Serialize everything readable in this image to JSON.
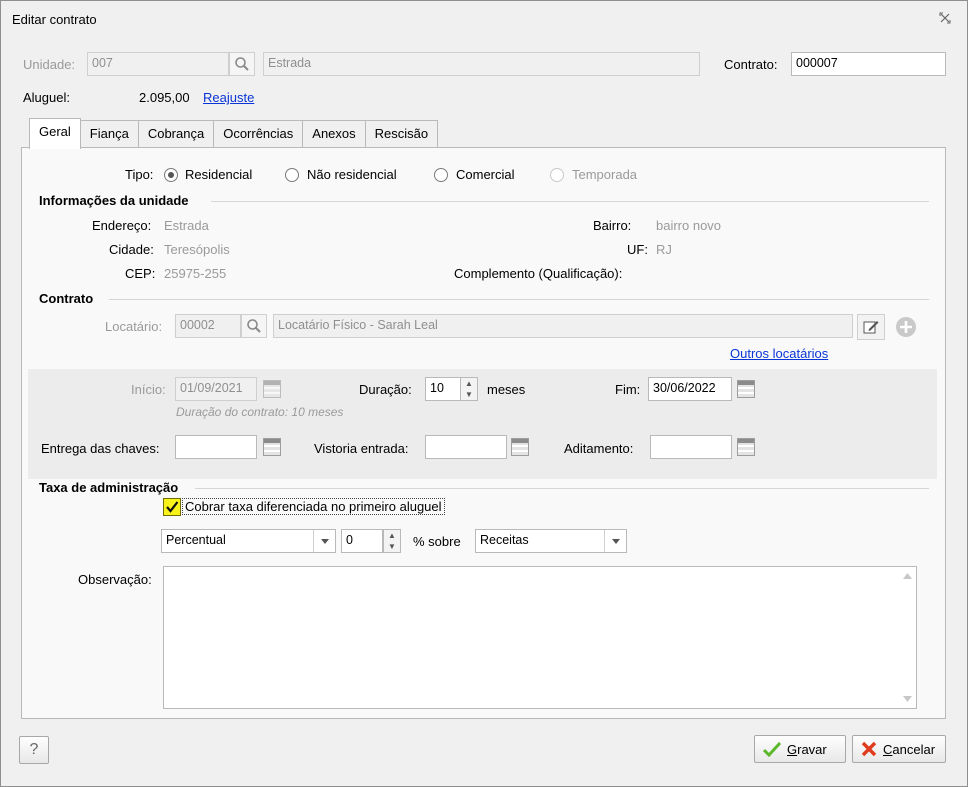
{
  "window": {
    "title": "Editar contrato"
  },
  "top": {
    "unidade_label": "Unidade:",
    "unidade_code": "007",
    "unidade_name": "Estrada",
    "contrato_label": "Contrato:",
    "contrato_value": "000007",
    "aluguel_label": "Aluguel:",
    "aluguel_value": "2.095,00",
    "reajuste_link": "Reajuste"
  },
  "tabs": [
    {
      "label": "Geral",
      "active": true
    },
    {
      "label": "Fiança"
    },
    {
      "label": "Cobrança"
    },
    {
      "label": "Ocorrências"
    },
    {
      "label": "Anexos"
    },
    {
      "label": "Rescisão"
    }
  ],
  "tipo": {
    "label": "Tipo:",
    "options": [
      "Residencial",
      "Não residencial",
      "Comercial",
      "Temporada"
    ],
    "selected": "Residencial"
  },
  "unidade_info": {
    "title": "Informações da unidade",
    "endereco_label": "Endereço:",
    "endereco": "Estrada",
    "bairro_label": "Bairro:",
    "bairro": "bairro novo",
    "cidade_label": "Cidade:",
    "cidade": "Teresópolis",
    "uf_label": "UF:",
    "uf": "RJ",
    "cep_label": "CEP:",
    "cep": "25975-255",
    "complemento_label": "Complemento (Qualificação):"
  },
  "contrato": {
    "title": "Contrato",
    "locatario_label": "Locatário:",
    "locatario_code": "00002",
    "locatario_name": "Locatário Físico - Sarah Leal",
    "outros_link": "Outros locatários",
    "inicio_label": "Início:",
    "inicio": "01/09/2021",
    "duracao_label": "Duração:",
    "duracao": "10",
    "meses_label": "meses",
    "fim_label": "Fim:",
    "fim": "30/06/2022",
    "duracao_info": "Duração do contrato: 10 meses",
    "entrega_label": "Entrega das chaves:",
    "vistoria_label": "Vistoria entrada:",
    "aditamento_label": "Aditamento:"
  },
  "taxa": {
    "title": "Taxa de administração",
    "checkbox_label": "Cobrar taxa diferenciada no primeiro aluguel",
    "checked": true,
    "tipo_select": "Percentual",
    "valor": "0",
    "sobre_label": "% sobre",
    "sobre_select": "Receitas"
  },
  "observacao": {
    "label": "Observação:"
  },
  "footer": {
    "help": "?",
    "gravar_prefix": "",
    "gravar_u": "G",
    "gravar_rest": "ravar",
    "cancelar_u": "C",
    "cancelar_rest": "ancelar"
  },
  "colors": {
    "accent_link": "#0a35d6",
    "checkbox_highlight": "#f7f219",
    "ok_green": "#4caf1a",
    "cancel_red": "#e03b1f"
  }
}
